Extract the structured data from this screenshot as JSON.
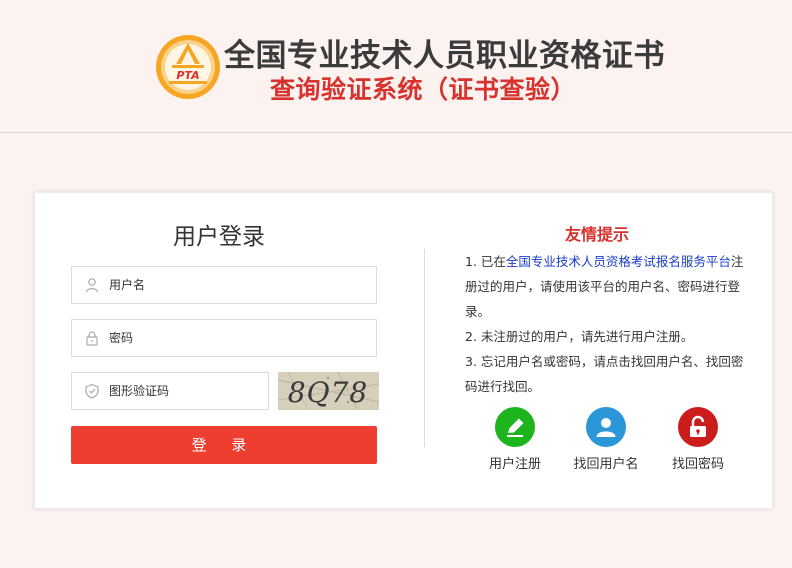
{
  "header": {
    "logo_text": "PTA",
    "title": "全国专业技术人员职业资格证书",
    "subtitle": "查询验证系统（证书查验）"
  },
  "login": {
    "title": "用户登录",
    "username_placeholder": "用户名",
    "password_placeholder": "密码",
    "captcha_placeholder": "图形验证码",
    "captcha_text": "8Q78",
    "submit_label": "登 录"
  },
  "tips": {
    "title": "友情提示",
    "item1_prefix": "1. 已在",
    "item1_link": "全国专业技术人员资格考试报名服务平台",
    "item1_suffix": "注册过的用户，请使用该平台的用户名、密码进行登录。",
    "item2": "2. 未注册过的用户，请先进行用户注册。",
    "item3": "3. 忘记用户名或密码，请点击找回用户名、找回密码进行找回。"
  },
  "actions": [
    {
      "label": "用户注册",
      "icon": "pencil-icon",
      "color": "#1db41d"
    },
    {
      "label": "找回用户名",
      "icon": "user-icon",
      "color": "#2b97d8"
    },
    {
      "label": "找回密码",
      "icon": "lock-icon",
      "color": "#cc1d1d"
    }
  ],
  "colors": {
    "accent_red": "#ee3e30",
    "title_red": "#d8322e",
    "link_blue": "#1a3cc8",
    "background": "#fcf3f1"
  }
}
